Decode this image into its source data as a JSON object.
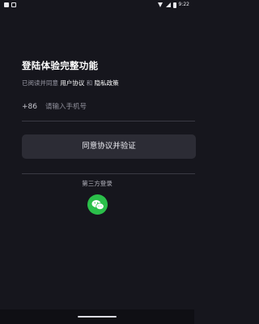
{
  "status_bar": {
    "time": "9:22",
    "icons": [
      "notification-icon",
      "notification-icon-2",
      "wifi-icon",
      "signal-icon",
      "battery-icon"
    ]
  },
  "login": {
    "title": "登陆体验完整功能",
    "agree_prefix": "已阅读并同意",
    "user_agreement": "用户协议",
    "and": "和",
    "privacy_policy": "隐私政策",
    "country_code": "+86",
    "phone_placeholder": "请输入手机号",
    "phone_value": "",
    "verify_button": "同意协议并验证",
    "third_party_title": "第三方登录",
    "third_party_icon": "wechat-icon"
  },
  "colors": {
    "background": "#16161d",
    "button": "#2c2c35",
    "wechat": "#2bbf4a"
  }
}
